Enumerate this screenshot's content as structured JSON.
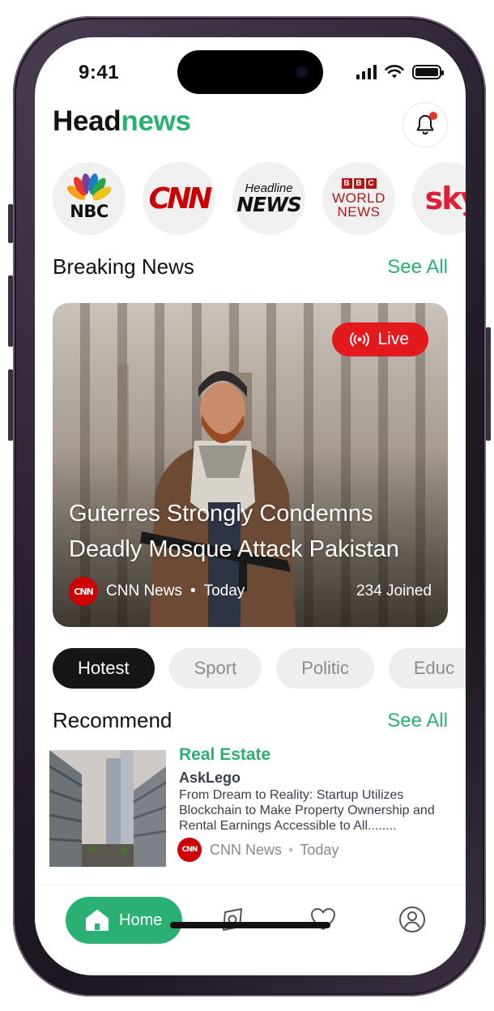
{
  "status_bar": {
    "time": "9:41"
  },
  "header": {
    "brand_main": "Head",
    "brand_accent": "news"
  },
  "channels": [
    {
      "name": "NBC",
      "icon": "nbc-peacock-logo"
    },
    {
      "name": "CNN"
    },
    {
      "line1": "Headline",
      "line2": "NEWS"
    },
    {
      "boxes": [
        "B",
        "B",
        "C"
      ],
      "line1": "WORLD",
      "line2": "NEWS"
    },
    {
      "name": "sky"
    }
  ],
  "breaking": {
    "title": "Breaking News",
    "see_all": "See All",
    "live_label": "Live",
    "headline_line1": "Guterres Strongly Condemns",
    "headline_line2": "Deadly Mosque Attack Pakistan",
    "source_logo_text": "CNN",
    "source": "CNN News",
    "separator": "•",
    "time": "Today",
    "joined": "234 Joined"
  },
  "categories": [
    {
      "label": "Hotest",
      "active": true
    },
    {
      "label": "Sport",
      "active": false
    },
    {
      "label": "Politic",
      "active": false
    },
    {
      "label": "Educ",
      "active": false
    }
  ],
  "recommend": {
    "title": "Recommend",
    "see_all": "See All",
    "items": [
      {
        "category": "Real Estate",
        "publisher": "AskLego",
        "description": "From Dream to Reality: Startup Utilizes Blockchain to Make Property Ownership and Rental Earnings Accessible to All........",
        "source_logo_text": "CNN",
        "source": "CNN News",
        "separator": "•",
        "time": "Today"
      }
    ]
  },
  "nav": {
    "home_label": "Home",
    "icons": [
      "home-icon",
      "explore-icon",
      "heart-icon",
      "profile-icon"
    ]
  },
  "colors": {
    "accent": "#2bb073",
    "live": "#e3191b",
    "brand_red": "#cc0000"
  }
}
